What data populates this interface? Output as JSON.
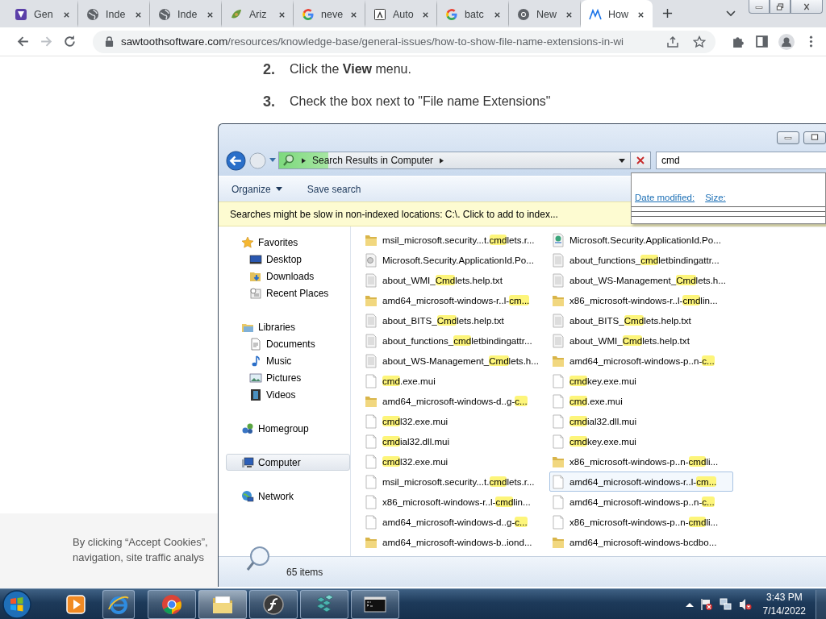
{
  "browser": {
    "tabs": [
      {
        "title": "Gen",
        "kind": "app",
        "selected": false
      },
      {
        "title": "Inde",
        "kind": "globe",
        "selected": false
      },
      {
        "title": "Inde",
        "kind": "globe",
        "selected": false
      },
      {
        "title": "Ariz",
        "kind": "leaf",
        "selected": false
      },
      {
        "title": "neve",
        "kind": "google",
        "selected": false
      },
      {
        "title": "Auto",
        "kind": "letter",
        "selected": false
      },
      {
        "title": "batc",
        "kind": "google",
        "selected": false
      },
      {
        "title": "New",
        "kind": "chrome",
        "selected": false
      },
      {
        "title": "How",
        "kind": "logo",
        "selected": true
      }
    ],
    "address": {
      "domain": "sawtoothsoftware.com",
      "path": "/resources/knowledge-base/general-issues/how-to-show-file-name-extensions-in-wi"
    }
  },
  "article": {
    "steps": [
      {
        "number": "2.",
        "text": "Click the **View** menu."
      },
      {
        "number": "3.",
        "text": "Check the box next to \"File name Extensions\""
      }
    ]
  },
  "explorer": {
    "address": "Search Results in Computer",
    "search_progress": {
      "level": 0.14
    },
    "search_value": "cmd",
    "commands": [
      {
        "label": "Organize",
        "menu": true
      },
      {
        "label": "Save search",
        "menu": false
      }
    ],
    "info_bar": "Searches might be slow in non-indexed locations: C:\\. Click to add to index...",
    "search_filters": [
      "Date modified:",
      "Size:"
    ],
    "nav": [
      {
        "label": "Favorites",
        "kind": "star",
        "selected": false,
        "children": [
          {
            "label": "Desktop",
            "kind": "desktop",
            "selected": false
          },
          {
            "label": "Downloads",
            "kind": "downloads",
            "selected": false
          },
          {
            "label": "Recent Places",
            "kind": "recent",
            "selected": false
          }
        ]
      },
      {
        "label": "Libraries",
        "kind": "libraries",
        "selected": false,
        "children": [
          {
            "label": "Documents",
            "kind": "documents",
            "selected": false
          },
          {
            "label": "Music",
            "kind": "music",
            "selected": false
          },
          {
            "label": "Pictures",
            "kind": "pictures",
            "selected": false
          },
          {
            "label": "Videos",
            "kind": "videos",
            "selected": false
          }
        ]
      },
      {
        "label": "Homegroup",
        "kind": "homegroup",
        "selected": false
      },
      {
        "label": "Computer",
        "kind": "computer",
        "selected": true
      },
      {
        "label": "Network",
        "kind": "network",
        "selected": false
      }
    ],
    "file_columns": [
      {
        "items": [
          {
            "kind": "folder",
            "hot": false,
            "parts": [
              {
                "text": "msil_microsoft.security...t.",
                "match": false
              },
              {
                "text": "cmd",
                "match": true
              },
              {
                "text": "lets.r...",
                "match": false
              }
            ]
          },
          {
            "kind": "script",
            "hot": false,
            "parts": [
              {
                "text": "Microsoft.Security.ApplicationId.Po...",
                "match": false
              }
            ]
          },
          {
            "kind": "text",
            "hot": false,
            "parts": [
              {
                "text": "about_WMI_",
                "match": false
              },
              {
                "text": "Cmd",
                "match": true
              },
              {
                "text": "lets.help.txt",
                "match": false
              }
            ]
          },
          {
            "kind": "folder",
            "hot": false,
            "parts": [
              {
                "text": "amd64_microsoft-windows-r..l-",
                "match": false
              },
              {
                "text": "cm...",
                "match": true
              }
            ]
          },
          {
            "kind": "text",
            "hot": false,
            "parts": [
              {
                "text": "about_BITS_",
                "match": false
              },
              {
                "text": "Cmd",
                "match": true
              },
              {
                "text": "lets.help.txt",
                "match": false
              }
            ]
          },
          {
            "kind": "text",
            "hot": false,
            "parts": [
              {
                "text": "about_functions_",
                "match": false
              },
              {
                "text": "cmd",
                "match": true
              },
              {
                "text": "letbindingattr...",
                "match": false
              }
            ]
          },
          {
            "kind": "text",
            "hot": false,
            "parts": [
              {
                "text": "about_WS-Management_",
                "match": false
              },
              {
                "text": "Cmd",
                "match": true
              },
              {
                "text": "lets.h...",
                "match": false
              }
            ]
          },
          {
            "kind": "blank",
            "hot": false,
            "parts": [
              {
                "text": "cmd",
                "match": true
              },
              {
                "text": ".exe.mui",
                "match": false
              }
            ]
          },
          {
            "kind": "folder",
            "hot": false,
            "parts": [
              {
                "text": "amd64_microsoft-windows-d..g-",
                "match": false
              },
              {
                "text": "c...",
                "match": true
              }
            ]
          },
          {
            "kind": "blank",
            "hot": false,
            "parts": [
              {
                "text": "cmd",
                "match": true
              },
              {
                "text": "l32.exe.mui",
                "match": false
              }
            ]
          },
          {
            "kind": "blank",
            "hot": false,
            "parts": [
              {
                "text": "cmd",
                "match": true
              },
              {
                "text": "ial32.dll.mui",
                "match": false
              }
            ]
          },
          {
            "kind": "blank",
            "hot": false,
            "parts": [
              {
                "text": "cmd",
                "match": true
              },
              {
                "text": "l32.exe.mui",
                "match": false
              }
            ]
          },
          {
            "kind": "blank",
            "hot": false,
            "parts": [
              {
                "text": "msil_microsoft.security...t.",
                "match": false
              },
              {
                "text": "cmd",
                "match": true
              },
              {
                "text": "lets.r...",
                "match": false
              }
            ]
          },
          {
            "kind": "blank",
            "hot": false,
            "parts": [
              {
                "text": "x86_microsoft-windows-r..l-",
                "match": false
              },
              {
                "text": "cmd",
                "match": true
              },
              {
                "text": "lin...",
                "match": false
              }
            ]
          },
          {
            "kind": "blank",
            "hot": false,
            "parts": [
              {
                "text": "amd64_microsoft-windows-d..g-",
                "match": false
              },
              {
                "text": "c...",
                "match": true
              }
            ]
          },
          {
            "kind": "folder",
            "hot": false,
            "parts": [
              {
                "text": "amd64_microsoft-windows-b..iond...",
                "match": false
              }
            ]
          }
        ]
      },
      {
        "items": [
          {
            "kind": "cert",
            "hot": false,
            "parts": [
              {
                "text": "Microsoft.Security.ApplicationId.Po...",
                "match": false
              }
            ]
          },
          {
            "kind": "text",
            "hot": false,
            "parts": [
              {
                "text": "about_functions_",
                "match": false
              },
              {
                "text": "cmd",
                "match": true
              },
              {
                "text": "letbindingattr...",
                "match": false
              }
            ]
          },
          {
            "kind": "text",
            "hot": false,
            "parts": [
              {
                "text": "about_WS-Management_",
                "match": false
              },
              {
                "text": "Cmd",
                "match": true
              },
              {
                "text": "lets.h...",
                "match": false
              }
            ]
          },
          {
            "kind": "folder",
            "hot": false,
            "parts": [
              {
                "text": "x86_microsoft-windows-r..l-",
                "match": false
              },
              {
                "text": "cmd",
                "match": true
              },
              {
                "text": "lin...",
                "match": false
              }
            ]
          },
          {
            "kind": "text",
            "hot": false,
            "parts": [
              {
                "text": "about_BITS_",
                "match": false
              },
              {
                "text": "Cmd",
                "match": true
              },
              {
                "text": "lets.help.txt",
                "match": false
              }
            ]
          },
          {
            "kind": "text",
            "hot": false,
            "parts": [
              {
                "text": "about_WMI_",
                "match": false
              },
              {
                "text": "Cmd",
                "match": true
              },
              {
                "text": "lets.help.txt",
                "match": false
              }
            ]
          },
          {
            "kind": "folder",
            "hot": false,
            "parts": [
              {
                "text": "amd64_microsoft-windows-p..n-",
                "match": false
              },
              {
                "text": "c...",
                "match": true
              }
            ]
          },
          {
            "kind": "blank",
            "hot": false,
            "parts": [
              {
                "text": "cmd",
                "match": true
              },
              {
                "text": "key.exe.mui",
                "match": false
              }
            ]
          },
          {
            "kind": "blank",
            "hot": false,
            "parts": [
              {
                "text": "cmd",
                "match": true
              },
              {
                "text": ".exe.mui",
                "match": false
              }
            ]
          },
          {
            "kind": "blank",
            "hot": false,
            "parts": [
              {
                "text": "cmd",
                "match": true
              },
              {
                "text": "ial32.dll.mui",
                "match": false
              }
            ]
          },
          {
            "kind": "blank",
            "hot": false,
            "parts": [
              {
                "text": "cmd",
                "match": true
              },
              {
                "text": "key.exe.mui",
                "match": false
              }
            ]
          },
          {
            "kind": "folder",
            "hot": false,
            "parts": [
              {
                "text": "x86_microsoft-windows-p..n-",
                "match": false
              },
              {
                "text": "cmd",
                "match": true
              },
              {
                "text": "li...",
                "match": false
              }
            ]
          },
          {
            "kind": "blank",
            "hot": true,
            "parts": [
              {
                "text": "amd64_microsoft-windows-r..l-",
                "match": false
              },
              {
                "text": "cm...",
                "match": true
              }
            ]
          },
          {
            "kind": "blank",
            "hot": false,
            "parts": [
              {
                "text": "amd64_microsoft-windows-p..n-",
                "match": false
              },
              {
                "text": "c...",
                "match": true
              }
            ]
          },
          {
            "kind": "blank",
            "hot": false,
            "parts": [
              {
                "text": "x86_microsoft-windows-p..n-",
                "match": false
              },
              {
                "text": "cmd",
                "match": true
              },
              {
                "text": "li...",
                "match": false
              }
            ]
          },
          {
            "kind": "folder",
            "hot": false,
            "parts": [
              {
                "text": "amd64_microsoft-windows-bcdbo...",
                "match": false
              }
            ]
          }
        ]
      }
    ],
    "status": "65 items"
  },
  "cookie_banner": {
    "lines": [
      "By clicking “Accept Cookies”,",
      "navigation, site traffic analys"
    ]
  },
  "taskbar": {
    "apps": [
      {
        "kind": "media",
        "open": false
      },
      {
        "kind": "ie",
        "open": true
      },
      {
        "kind": "chrome",
        "open": true
      },
      {
        "kind": "explorer",
        "open": true
      },
      {
        "kind": "flash",
        "open": true
      },
      {
        "kind": "cubes",
        "open": true
      },
      {
        "kind": "cmd",
        "open": true
      }
    ],
    "time": "3:43 PM",
    "date": "7/14/2022"
  }
}
